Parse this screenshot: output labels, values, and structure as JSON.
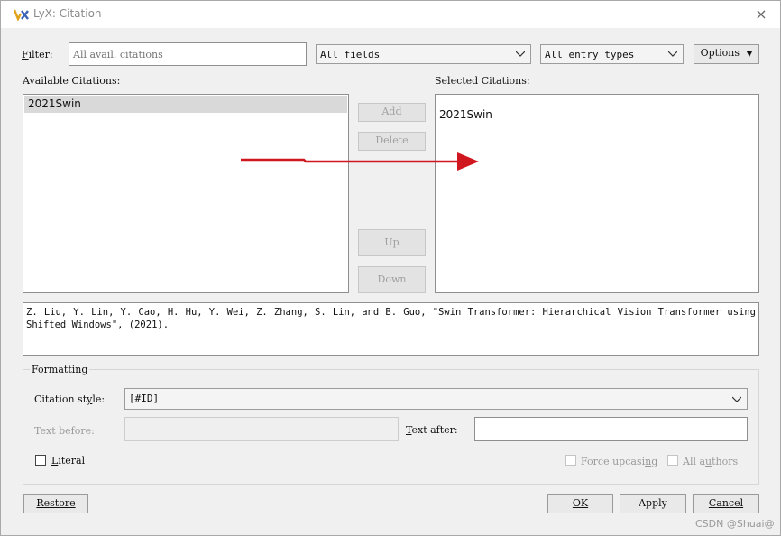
{
  "window": {
    "title": "LyX: Citation",
    "close_label": "×"
  },
  "filter": {
    "label": "Filter:",
    "placeholder": "All avail. citations",
    "fields_combo": "All fields",
    "types_combo": "All entry types",
    "options_button": "Options"
  },
  "available": {
    "heading": "Available Citations:",
    "items": [
      "2021Swin"
    ]
  },
  "selected": {
    "heading": "Selected Citations:",
    "items": [
      "2021Swin"
    ]
  },
  "middle_buttons": {
    "add": "Add",
    "delete": "Delete",
    "up": "Up",
    "down": "Down"
  },
  "info_text": "Z. Liu, Y. Lin, Y. Cao, H. Hu, Y. Wei, Z. Zhang, S. Lin, and B. Guo, \"Swin Transformer: Hierarchical Vision Transformer using Shifted Windows\", (2021).",
  "formatting": {
    "group_title": "Formatting",
    "style_label": "Citation style:",
    "style_value": "[#ID]",
    "text_before_label": "Text before:",
    "text_before_value": "",
    "text_after_label": "Text after:",
    "text_after_value": "",
    "literal_label": "Literal",
    "force_upcasing_label": "Force upcasing",
    "all_authors_label": "All authors"
  },
  "bottom_buttons": {
    "restore": "Restore",
    "ok": "OK",
    "apply": "Apply",
    "cancel": "Cancel"
  },
  "watermark": "CSDN @Shuai@",
  "colors": {
    "arrow": "#d0161e",
    "background_highlight": "#ffff2e"
  }
}
